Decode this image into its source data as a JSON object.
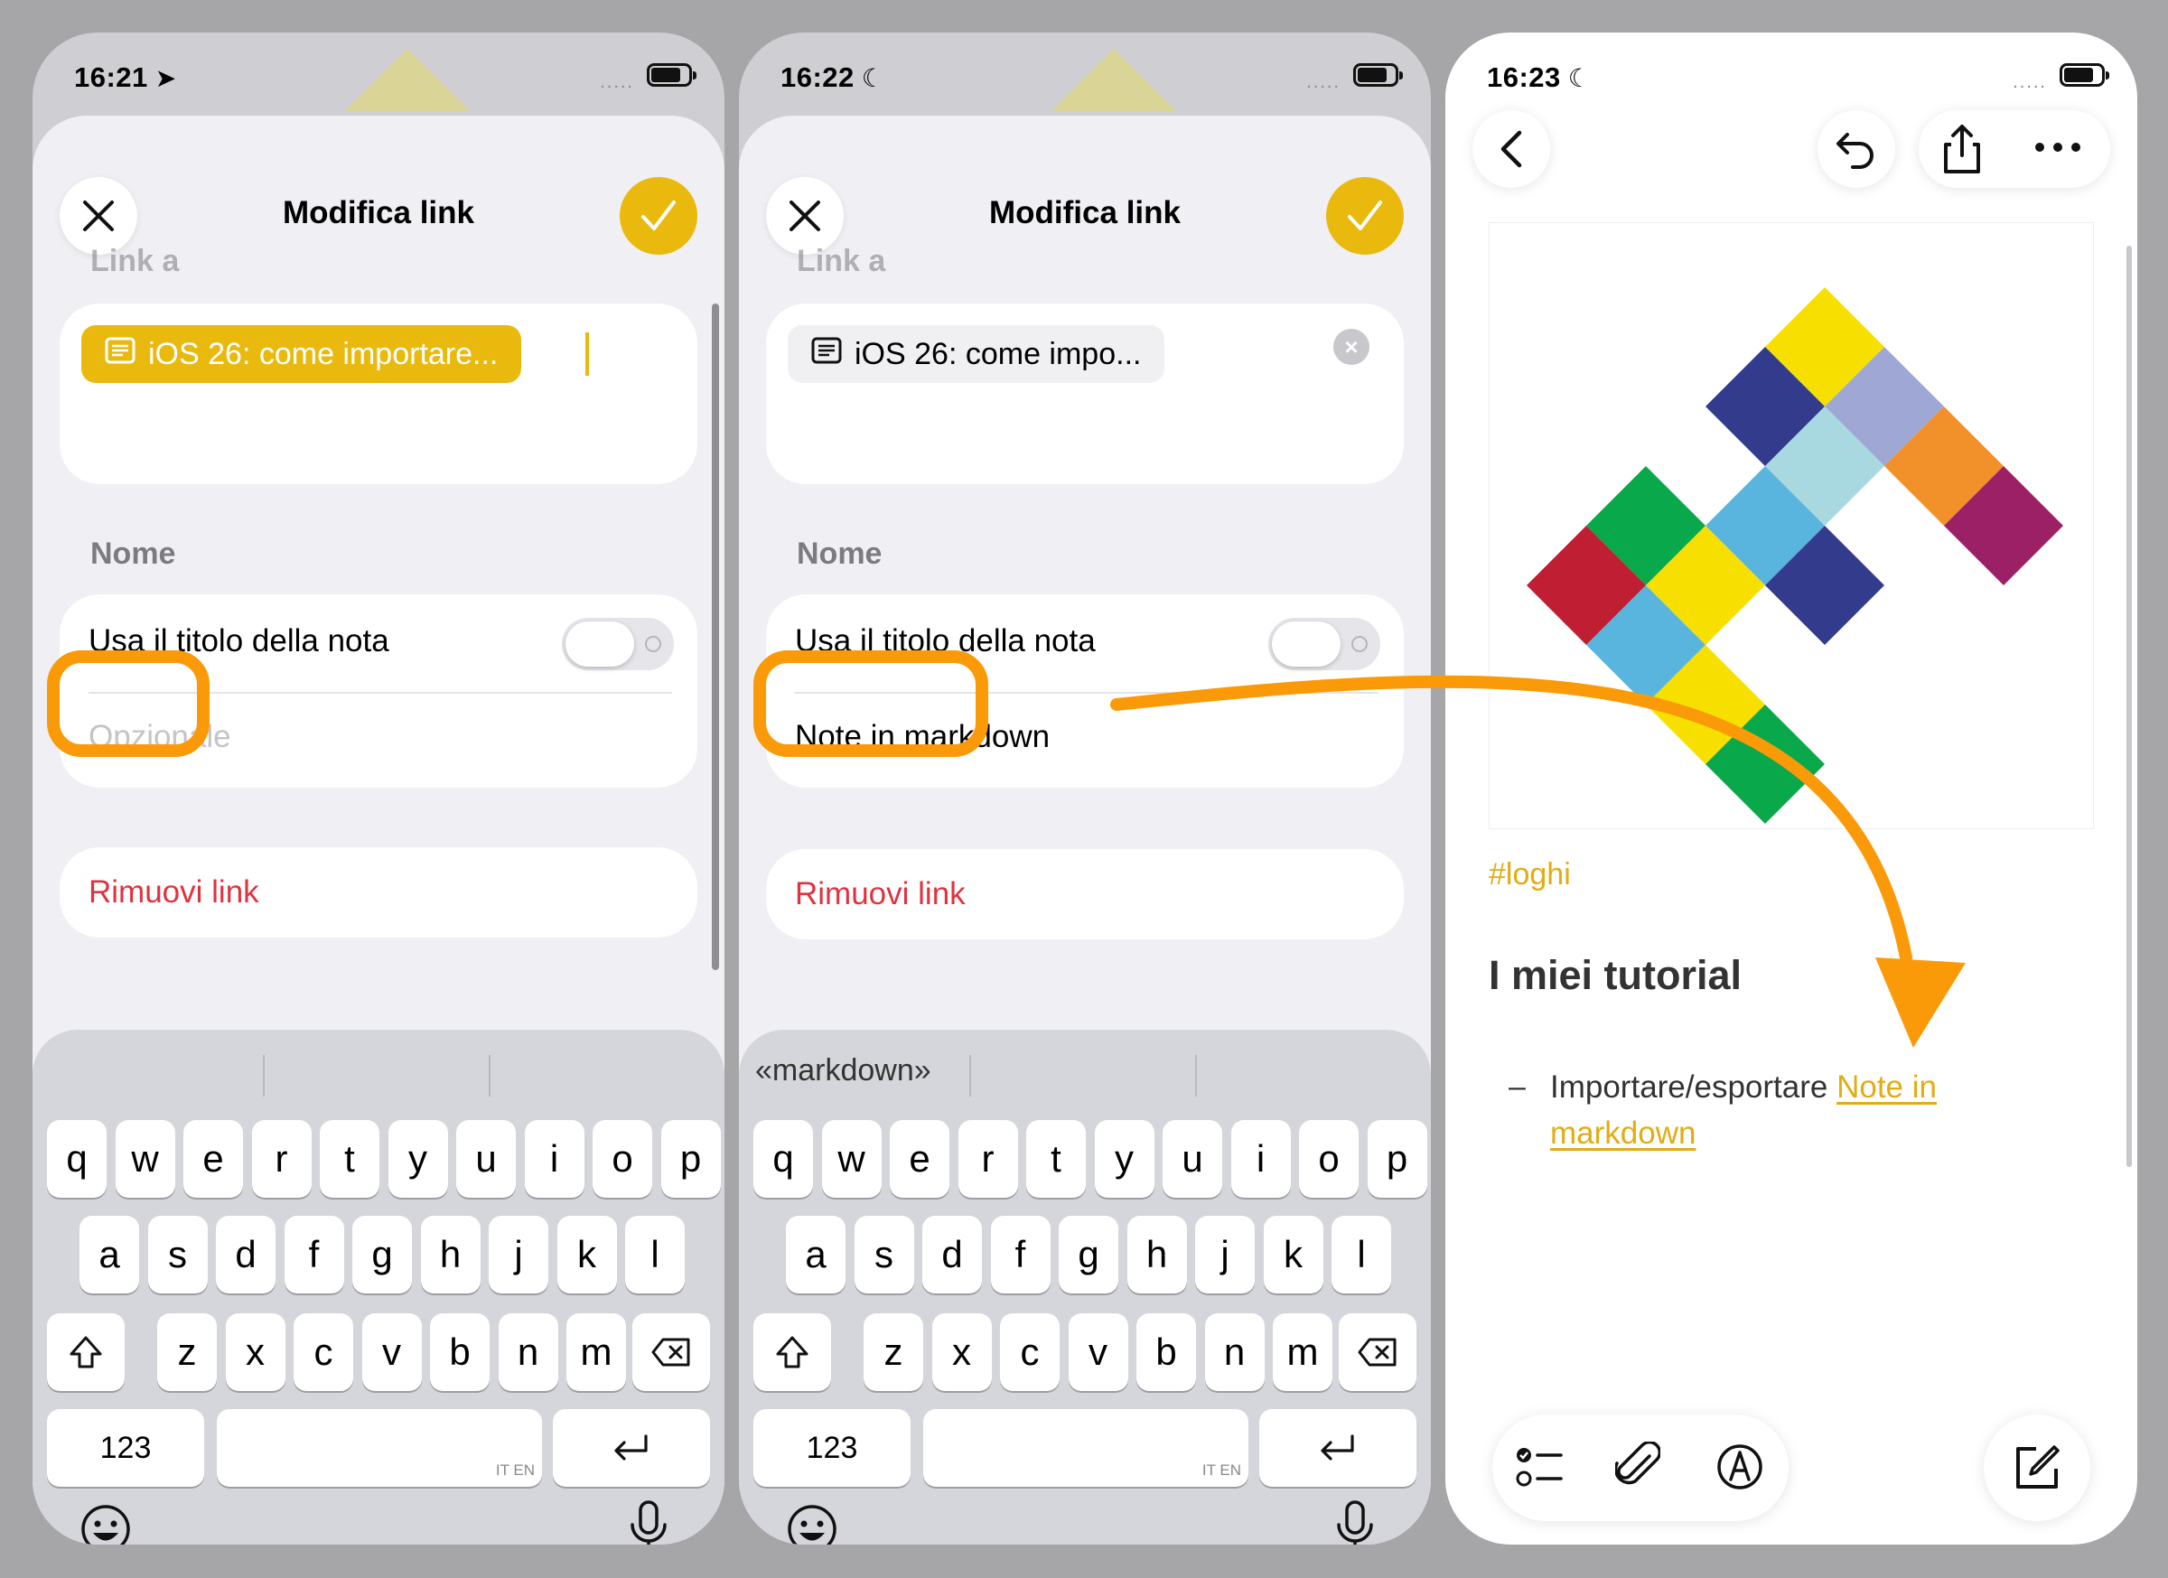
{
  "phone1": {
    "status": {
      "time": "16:21",
      "signal": "....."
    },
    "title": "Modifica link",
    "link_section_label": "Link a",
    "link_chip": "iOS 26: come importare...",
    "name_section_label": "Nome",
    "toggle_label": "Usa il titolo della nota",
    "name_placeholder": "Opzionale",
    "remove_link": "Rimuovi link",
    "suggestions": [
      "",
      "",
      ""
    ]
  },
  "phone2": {
    "status": {
      "time": "16:22",
      "signal": "....."
    },
    "title": "Modifica link",
    "link_section_label": "Link a",
    "link_chip": "iOS 26: come impo...",
    "name_section_label": "Nome",
    "toggle_label": "Usa il titolo della nota",
    "name_value": "Note in markdown",
    "remove_link": "Rimuovi link",
    "suggestions": [
      "«markdown»",
      "",
      ""
    ]
  },
  "keyboard": {
    "row1": [
      "q",
      "w",
      "e",
      "r",
      "t",
      "y",
      "u",
      "i",
      "o",
      "p"
    ],
    "row2": [
      "a",
      "s",
      "d",
      "f",
      "g",
      "h",
      "j",
      "k",
      "l"
    ],
    "row3": [
      "z",
      "x",
      "c",
      "v",
      "b",
      "n",
      "m"
    ],
    "numbers_key": "123",
    "space_lang": "IT EN"
  },
  "phone3": {
    "status": {
      "time": "16:23",
      "signal": "....."
    },
    "tag": "#loghi",
    "heading": "I miei tutorial",
    "bullet_dash": "–",
    "bullet_text": "Importare/esportare ",
    "bullet_link": "Note in markdown"
  },
  "colors": {
    "accent_yellow": "#eab90d",
    "annotation_orange": "#fa9a08",
    "danger_red": "#e0323f",
    "link_yellow": "#e2ac12"
  },
  "icons": {
    "close": "close-icon",
    "done": "checkmark-icon",
    "note": "note-icon",
    "shift": "shift-icon",
    "delete": "delete-icon",
    "return": "return-icon",
    "emoji": "emoji-icon",
    "mic": "microphone-icon",
    "back": "chevron-left-icon",
    "undo": "undo-icon",
    "share": "share-icon",
    "more": "ellipsis-icon",
    "checklist": "checklist-icon",
    "attach": "paperclip-icon",
    "markup": "markup-pen-icon",
    "compose": "compose-icon"
  }
}
